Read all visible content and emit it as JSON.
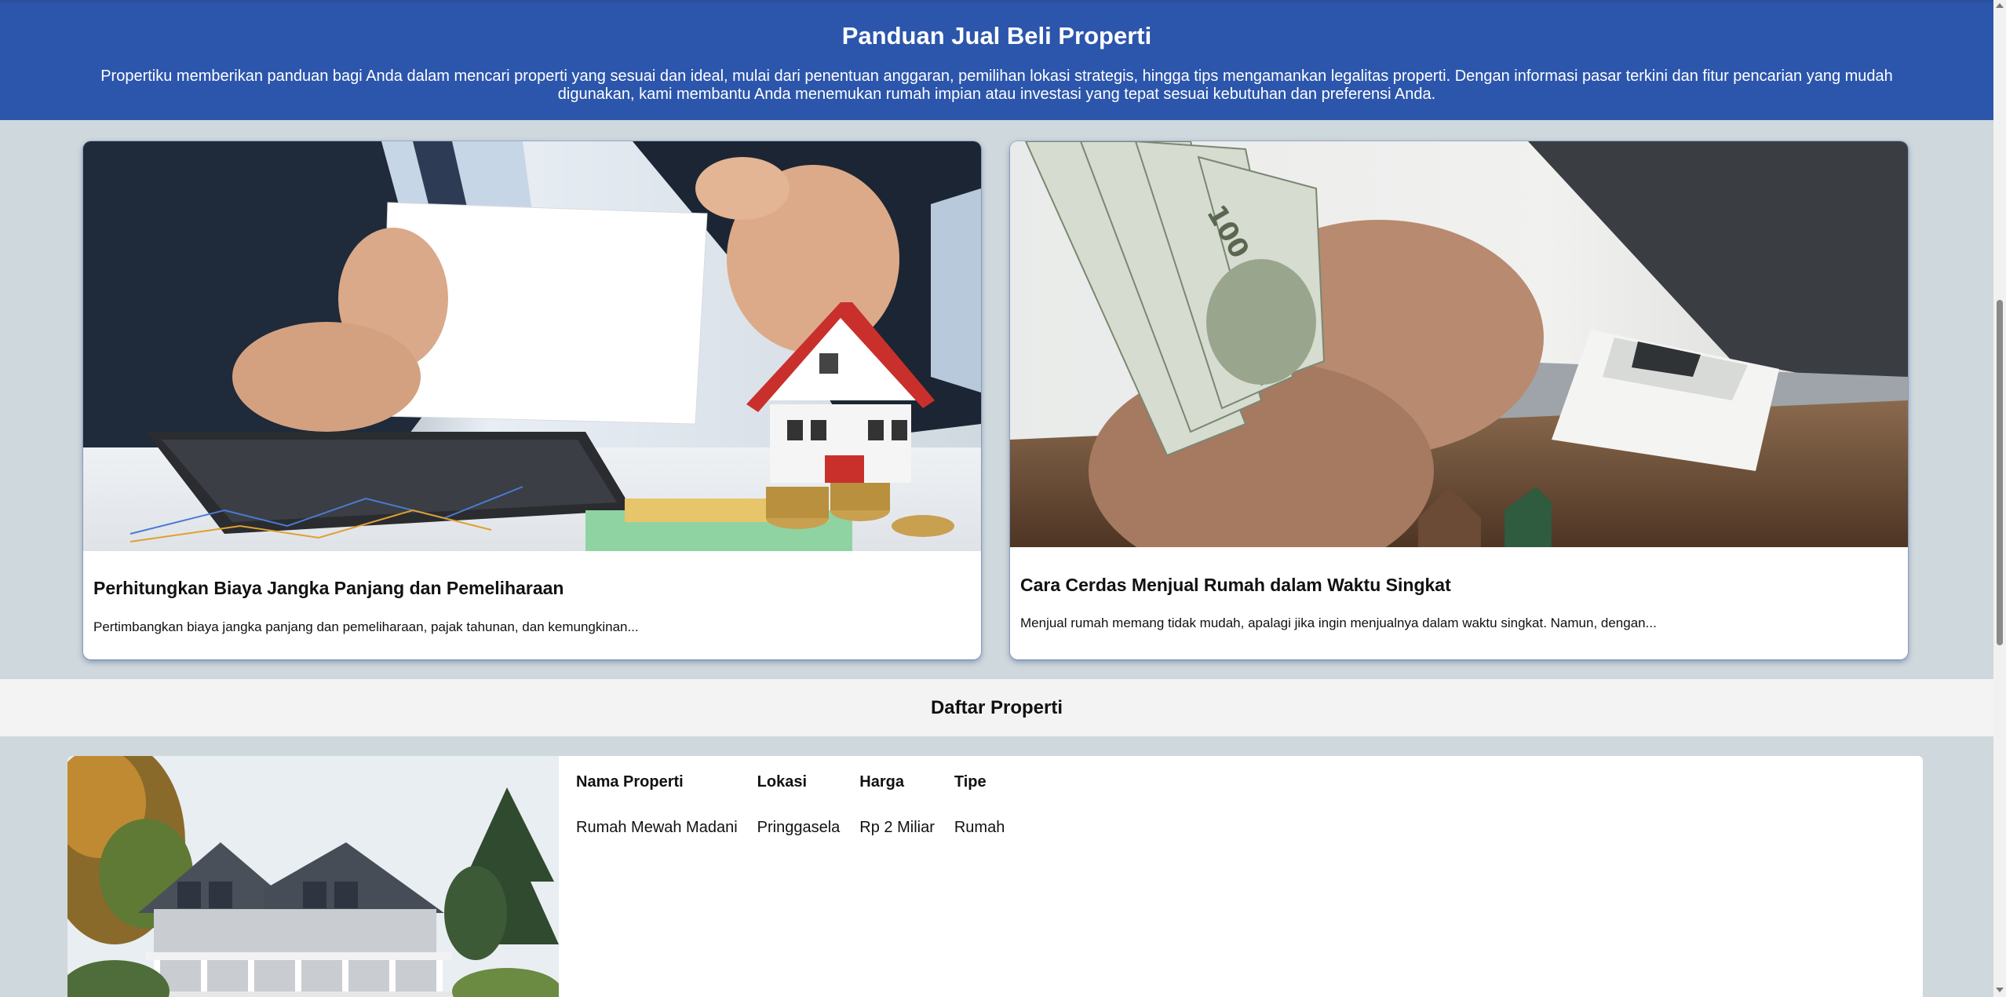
{
  "hero": {
    "title": "Panduan Jual Beli Properti",
    "description": "Propertiku memberikan panduan bagi Anda dalam mencari properti yang sesuai dan ideal, mulai dari penentuan anggaran, pemilihan lokasi strategis, hingga tips mengamankan legalitas properti. Dengan informasi pasar terkini dan fitur pencarian yang mudah digunakan, kami membantu Anda menemukan rumah impian atau investasi yang tepat sesuai kebutuhan dan preferensi Anda."
  },
  "articles": [
    {
      "title": "Perhitungkan Biaya Jangka Panjang dan Pemeliharaan",
      "excerpt": "Pertimbangkan biaya jangka panjang dan pemeliharaan, pajak tahunan, dan kemungkinan..."
    },
    {
      "title": "Cara Cerdas Menjual Rumah dalam Waktu Singkat",
      "excerpt": "Menjual rumah memang tidak mudah, apalagi jika ingin menjualnya dalam waktu singkat. Namun, dengan..."
    }
  ],
  "property_section": {
    "title": "Daftar Properti",
    "headers": [
      "Nama Properti",
      "Lokasi",
      "Harga",
      "Tipe"
    ],
    "rows": [
      [
        "Rumah Mewah Madani",
        "Pringgasela",
        "Rp 2 Miliar",
        "Rumah"
      ]
    ]
  },
  "colors": {
    "hero_bg": "#2c56ac",
    "page_bg": "#cfd8dc",
    "section_title_bg": "#f3f3f3"
  }
}
